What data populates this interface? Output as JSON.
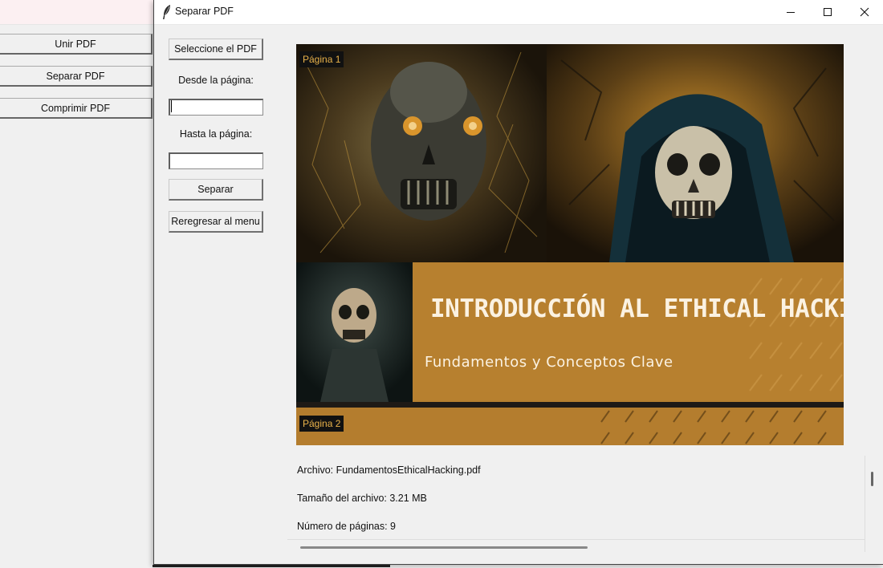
{
  "menu_window": {
    "buttons": [
      "Unir PDF",
      "Separar PDF",
      "Comprimir PDF"
    ]
  },
  "split_window": {
    "title": "Separar PDF",
    "controls": {
      "select_pdf": "Seleccione el PDF",
      "from_label": "Desde la página:",
      "from_value": "",
      "to_label": "Hasta la página:",
      "to_value": "",
      "split_button": "Separar",
      "back_button": "Reregresar al menu"
    },
    "preview": {
      "page1_tag": "Página 1",
      "page2_tag": "Página 2",
      "cover_title": "INTRODUCCIÓN AL ETHICAL HACKING",
      "cover_subtitle": "Fundamentos y Conceptos Clave"
    },
    "info": {
      "file": "Archivo: FundamentosEthicalHacking.pdf",
      "size": "Tamaño del archivo: 3.21 MB",
      "pages": "Número de páginas: 9"
    }
  },
  "colors": {
    "accent_orange": "#b7802f",
    "tag_text": "#e9b24a"
  }
}
